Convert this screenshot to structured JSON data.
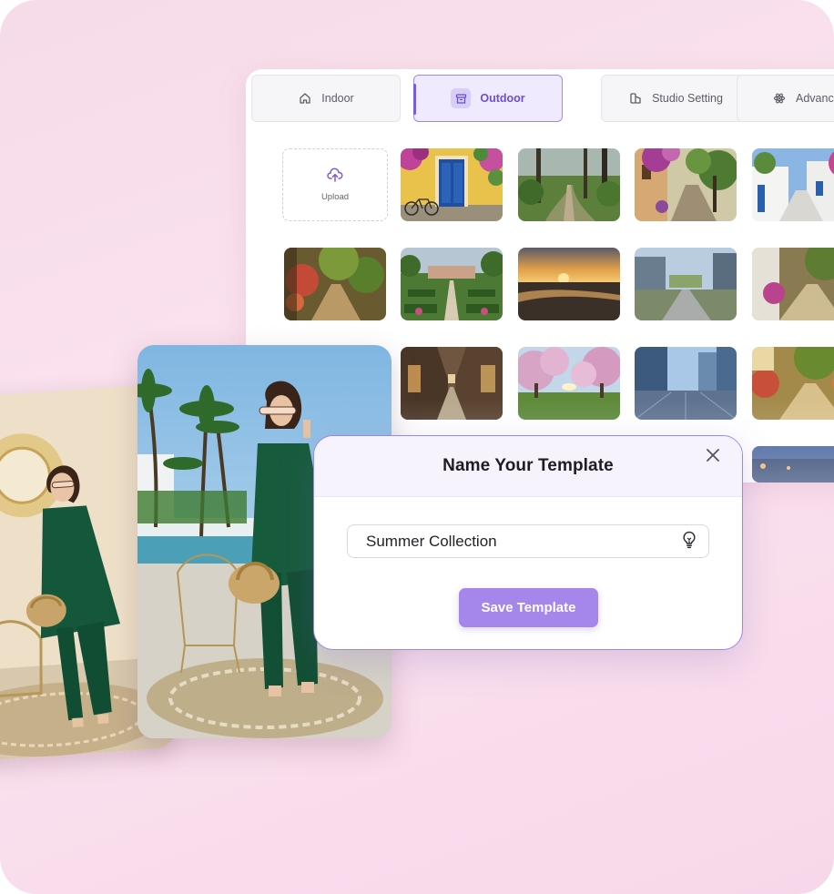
{
  "tabs": [
    {
      "label": "Indoor",
      "icon": "home-icon",
      "active": false
    },
    {
      "label": "Outdoor",
      "icon": "archive-box-icon",
      "active": true
    },
    {
      "label": "Studio Setting",
      "icon": "studio-icon",
      "active": false
    },
    {
      "label": "Advanc",
      "icon": "atom-icon",
      "active": false
    }
  ],
  "gallery": {
    "upload_label": "Upload",
    "scenes": [
      "yellow-wall-blue-door-bicycle",
      "forest-path",
      "village-street-flowers",
      "greek-whitewashed-alley",
      "garden-arcade-path",
      "formal-garden-hedges",
      "sunset-beach",
      "modern-plaza",
      "stone-path-flowers",
      "shop-lined-arcade",
      "cherry-blossom-park",
      "glass-towers-plaza",
      "sunlit-garden-walkway",
      "dusk-cityscape"
    ]
  },
  "modal": {
    "title": "Name Your Template",
    "input_value": "Summer Collection",
    "save_label": "Save Template"
  },
  "colors": {
    "accent": "#a586ea",
    "accent_dark": "#6a4fd0",
    "background": "#f9e0ec"
  }
}
